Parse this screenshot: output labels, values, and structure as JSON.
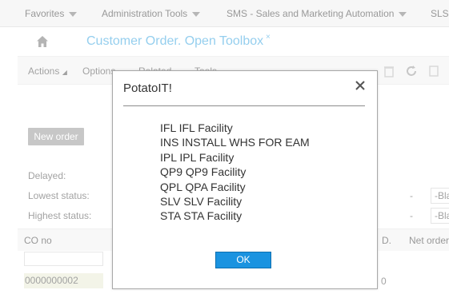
{
  "menubar": {
    "items": [
      "Favorites",
      "Administration Tools",
      "SMS - Sales and Marketing Automation",
      "SLS"
    ]
  },
  "tab": {
    "title": "Customer Order. Open Toolbox",
    "close_glyph": "×"
  },
  "toolbar": {
    "items": [
      "Actions",
      "Options",
      "Related",
      "Tools"
    ]
  },
  "form": {
    "new_order_label": "New order",
    "labels": [
      "Delayed:",
      "Lowest status:",
      "Highest status:"
    ],
    "dash": "-",
    "select_value": "-Bla"
  },
  "grid": {
    "headers": [
      "CO no",
      "D.",
      "Net order"
    ],
    "rows": [
      {
        "co_no": "0000000002",
        "d": "0"
      }
    ]
  },
  "dialog": {
    "title": "PotatoIT!",
    "close_glyph": "×",
    "lines": [
      "IFL IFL Facility",
      "INS INSTALL WHS FOR EAM",
      "IPL IPL Facility",
      "QP9 QP9 Facility",
      "QPL QPA Facility",
      "SLV SLV Facility",
      "STA STA Facility"
    ],
    "ok_label": "OK"
  },
  "colors": {
    "accent": "#3da7e0",
    "ok_button": "#1a93e0"
  }
}
